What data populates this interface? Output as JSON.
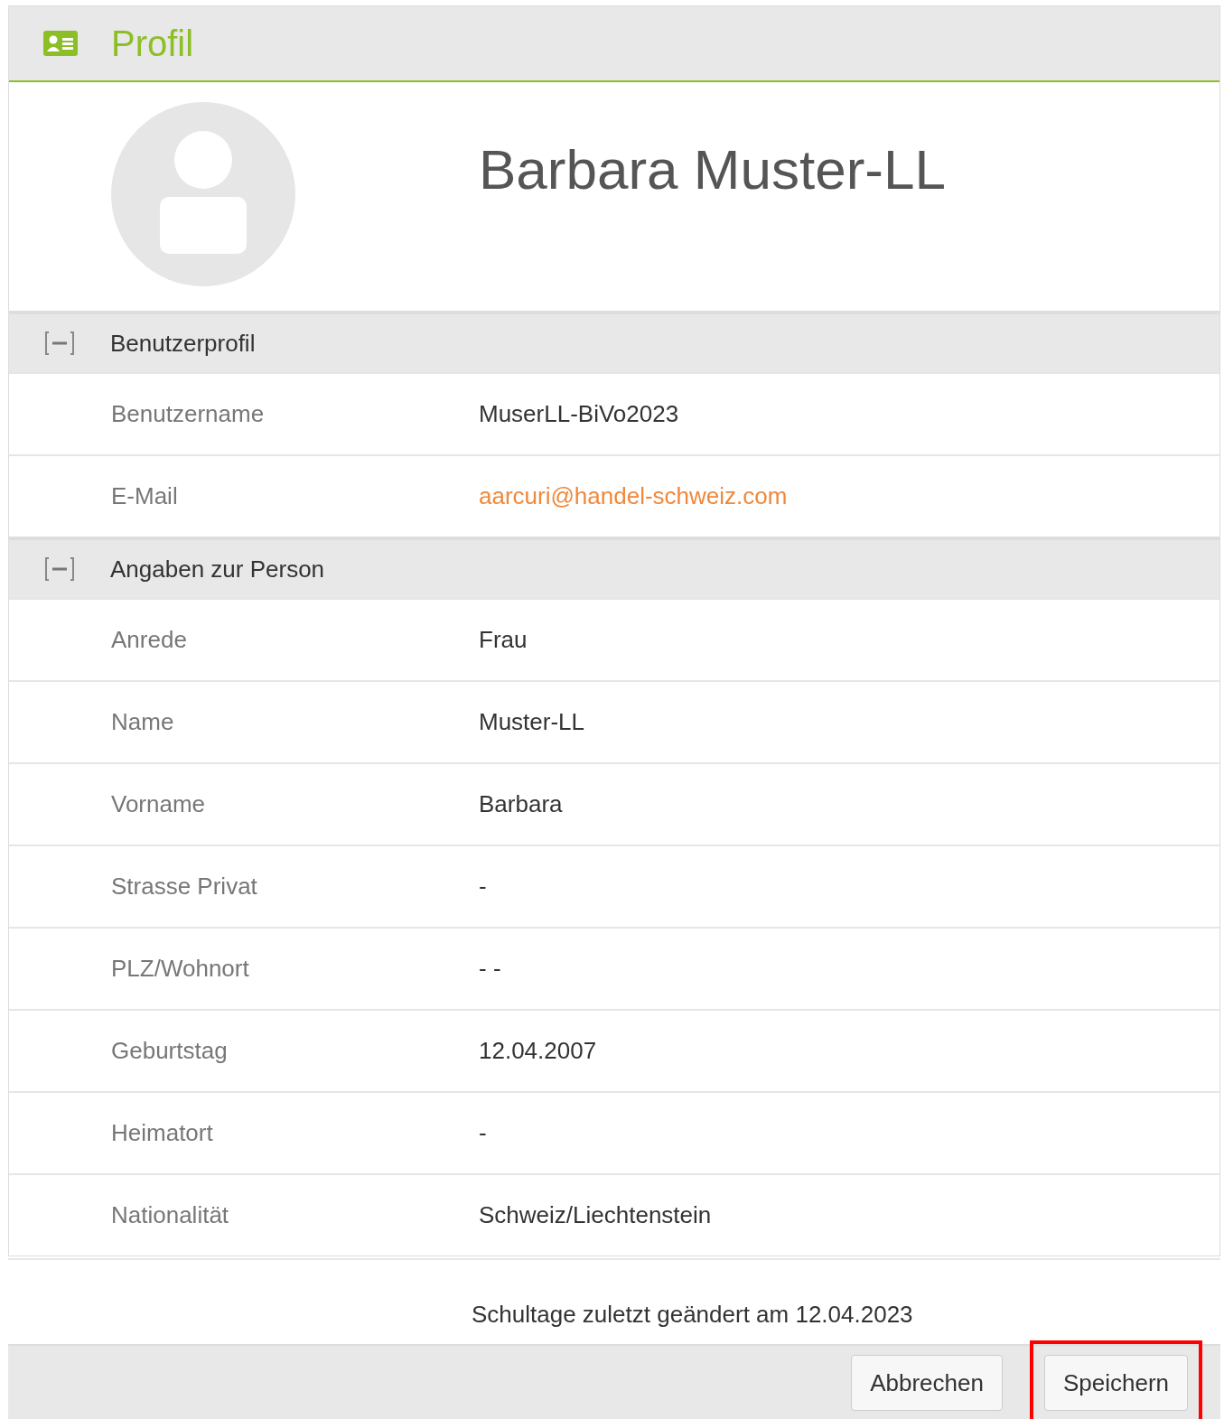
{
  "header": {
    "title": "Profil"
  },
  "profile": {
    "name": "Barbara Muster-LL"
  },
  "sections": [
    {
      "heading": "Benutzerprofil",
      "expanded": true,
      "rows": [
        {
          "label": "Benutzername",
          "value": "MuserLL-BiVo2023",
          "kind": "text"
        },
        {
          "label": "E-Mail",
          "value": "aarcuri@handel-schweiz.com",
          "kind": "link"
        }
      ]
    },
    {
      "heading": "Angaben zur Person",
      "expanded": true,
      "rows": [
        {
          "label": "Anrede",
          "value": "Frau",
          "kind": "text"
        },
        {
          "label": "Name",
          "value": "Muster-LL",
          "kind": "text"
        },
        {
          "label": "Vorname",
          "value": "Barbara",
          "kind": "text"
        },
        {
          "label": "Strasse Privat",
          "value": "-",
          "kind": "text"
        },
        {
          "label": "PLZ/Wohnort",
          "value": "- -",
          "kind": "text"
        },
        {
          "label": "Geburtstag",
          "value": "12.04.2007",
          "kind": "text"
        },
        {
          "label": "Heimatort",
          "value": "-",
          "kind": "text"
        },
        {
          "label": "Nationalität",
          "value": "Schweiz/Liechtenstein",
          "kind": "text"
        }
      ]
    }
  ],
  "footer": {
    "note": "Schultage zuletzt geändert am 12.04.2023",
    "buttons": [
      {
        "label": "Abbrechen",
        "highlighted": false
      },
      {
        "label": "Speichern",
        "highlighted": true
      }
    ]
  }
}
